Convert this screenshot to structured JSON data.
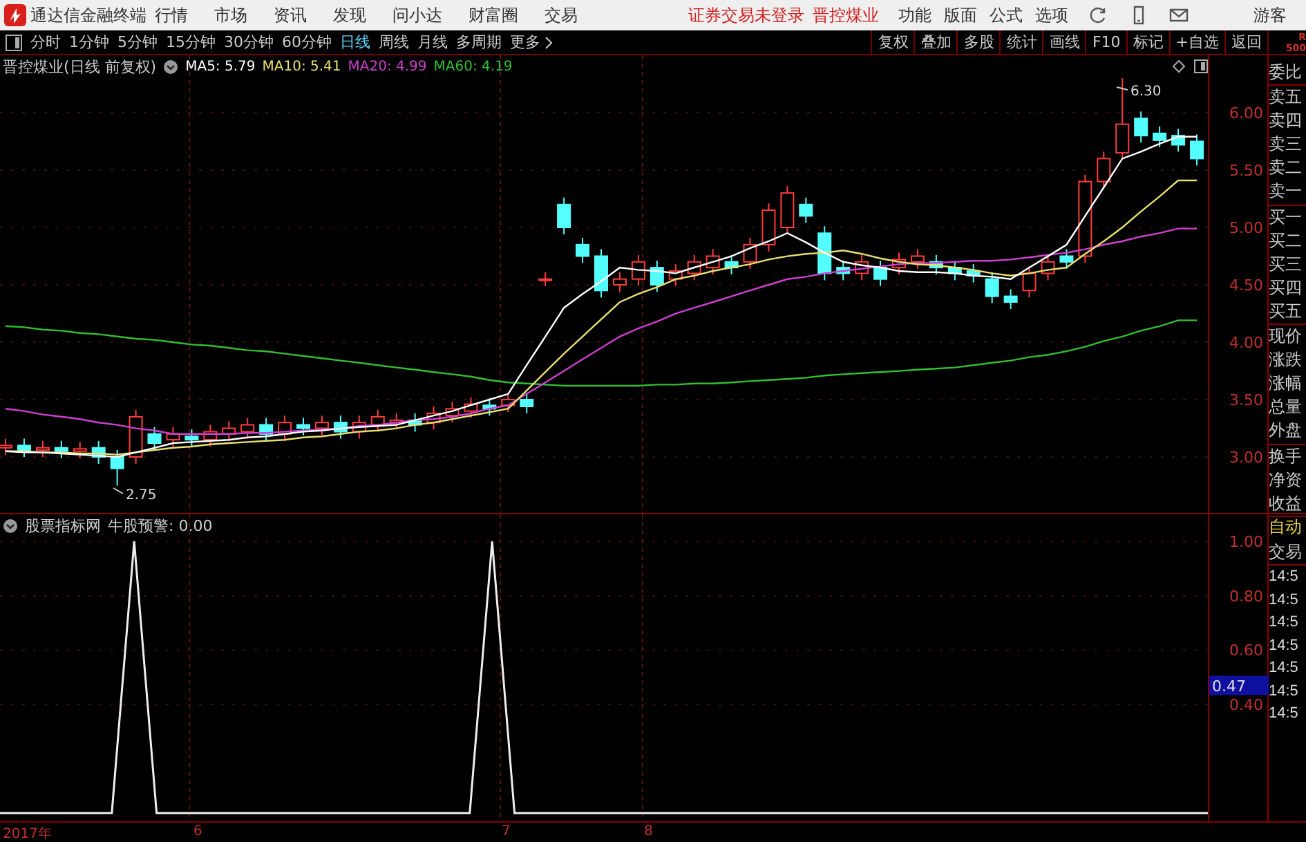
{
  "menu_bar": {
    "app_title": "通达信金融终端",
    "menus": [
      "行情",
      "市场",
      "资讯",
      "发现",
      "问小达",
      "财富圈",
      "交易"
    ],
    "status": [
      "证券交易未登录",
      "晋控煤业"
    ],
    "right_menus": [
      "功能",
      "版面",
      "公式",
      "选项"
    ],
    "user": "游客"
  },
  "period_tabs": [
    {
      "label": "分时",
      "selected": false
    },
    {
      "label": "1分钟",
      "selected": false
    },
    {
      "label": "5分钟",
      "selected": false
    },
    {
      "label": "15分钟",
      "selected": false
    },
    {
      "label": "30分钟",
      "selected": false
    },
    {
      "label": "60分钟",
      "selected": false
    },
    {
      "label": "日线",
      "selected": true
    },
    {
      "label": "周线",
      "selected": false
    },
    {
      "label": "月线",
      "selected": false
    },
    {
      "label": "多周期",
      "selected": false
    },
    {
      "label": "更多",
      "selected": false
    }
  ],
  "toolbar_buttons": [
    "复权",
    "叠加",
    "多股",
    "统计",
    "画线",
    "F10",
    "标记",
    "+自选",
    "返回"
  ],
  "corner_label": [
    "R",
    "500"
  ],
  "main_chart": {
    "title": "晋控煤业(日线 前复权)",
    "high_label": "6.30",
    "low_label": "2.75",
    "chart_data": {
      "type": "candlestick",
      "grid": true,
      "categories": [
        null,
        null,
        null,
        null,
        null,
        null,
        null,
        null,
        null,
        null,
        null,
        null,
        null,
        null,
        null,
        null,
        null,
        null,
        null,
        null,
        null,
        null,
        null,
        null,
        null,
        null,
        null,
        null,
        null,
        null,
        null,
        null,
        null,
        null,
        null,
        null,
        null,
        null,
        null,
        null,
        null,
        null,
        null,
        null,
        null,
        null,
        null,
        null,
        null,
        null,
        null,
        null,
        null,
        null,
        null,
        null,
        null,
        null,
        null,
        null,
        null,
        null,
        null,
        null,
        null
      ],
      "ylim": [
        2.5,
        6.5
      ],
      "yticks": [
        {
          "value": 6,
          "label": "6.00"
        },
        {
          "value": 5.5,
          "label": "5.50"
        },
        {
          "value": 5,
          "label": "5.00"
        },
        {
          "value": 4.5,
          "label": "4.50"
        },
        {
          "value": 4,
          "label": "4.00"
        },
        {
          "value": 3.5,
          "label": "3.50"
        },
        {
          "value": 3,
          "label": "3.00"
        }
      ],
      "ohlc": [
        [
          3.08,
          3.16,
          3.02,
          3.1
        ],
        [
          3.1,
          3.16,
          3.0,
          3.06
        ],
        [
          3.06,
          3.14,
          3.0,
          3.08
        ],
        [
          3.08,
          3.14,
          2.99,
          3.05
        ],
        [
          3.05,
          3.13,
          2.99,
          3.07
        ],
        [
          3.08,
          3.14,
          2.94,
          3.0
        ],
        [
          3.0,
          3.06,
          2.75,
          2.9
        ],
        [
          3.0,
          3.41,
          2.94,
          3.35
        ],
        [
          3.2,
          3.26,
          3.06,
          3.12
        ],
        [
          3.15,
          3.26,
          3.09,
          3.2
        ],
        [
          3.18,
          3.24,
          3.09,
          3.15
        ],
        [
          3.15,
          3.28,
          3.09,
          3.22
        ],
        [
          3.2,
          3.31,
          3.14,
          3.25
        ],
        [
          3.22,
          3.34,
          3.16,
          3.28
        ],
        [
          3.28,
          3.34,
          3.14,
          3.2
        ],
        [
          3.2,
          3.36,
          3.14,
          3.3
        ],
        [
          3.28,
          3.34,
          3.19,
          3.25
        ],
        [
          3.25,
          3.36,
          3.19,
          3.3
        ],
        [
          3.3,
          3.36,
          3.16,
          3.22
        ],
        [
          3.22,
          3.36,
          3.16,
          3.3
        ],
        [
          3.28,
          3.41,
          3.22,
          3.35
        ],
        [
          3.3,
          3.38,
          3.24,
          3.32
        ],
        [
          3.32,
          3.38,
          3.22,
          3.28
        ],
        [
          3.3,
          3.44,
          3.24,
          3.38
        ],
        [
          3.36,
          3.48,
          3.3,
          3.42
        ],
        [
          3.4,
          3.52,
          3.34,
          3.46
        ],
        [
          3.45,
          3.51,
          3.36,
          3.42
        ],
        [
          3.45,
          3.56,
          3.39,
          3.5
        ],
        [
          3.5,
          3.56,
          3.38,
          3.44
        ],
        [
          4.55,
          4.61,
          4.49,
          4.55
        ],
        [
          5.2,
          5.26,
          4.94,
          5.0
        ],
        [
          4.85,
          4.91,
          4.69,
          4.75
        ],
        [
          4.75,
          4.81,
          4.39,
          4.45
        ],
        [
          4.5,
          4.61,
          4.44,
          4.55
        ],
        [
          4.55,
          4.76,
          4.49,
          4.7
        ],
        [
          4.65,
          4.71,
          4.44,
          4.5
        ],
        [
          4.55,
          4.68,
          4.49,
          4.62
        ],
        [
          4.6,
          4.76,
          4.54,
          4.7
        ],
        [
          4.65,
          4.81,
          4.59,
          4.75
        ],
        [
          4.7,
          4.76,
          4.59,
          4.65
        ],
        [
          4.7,
          4.91,
          4.64,
          4.85
        ],
        [
          4.85,
          5.21,
          4.79,
          5.15
        ],
        [
          5.0,
          5.36,
          4.94,
          5.3
        ],
        [
          5.2,
          5.26,
          5.04,
          5.1
        ],
        [
          4.95,
          5.01,
          4.54,
          4.6
        ],
        [
          4.65,
          4.71,
          4.54,
          4.6
        ],
        [
          4.6,
          4.76,
          4.54,
          4.7
        ],
        [
          4.65,
          4.71,
          4.49,
          4.55
        ],
        [
          4.65,
          4.78,
          4.59,
          4.72
        ],
        [
          4.7,
          4.81,
          4.64,
          4.75
        ],
        [
          4.7,
          4.76,
          4.59,
          4.65
        ],
        [
          4.65,
          4.71,
          4.54,
          4.6
        ],
        [
          4.62,
          4.68,
          4.52,
          4.58
        ],
        [
          4.55,
          4.61,
          4.34,
          4.4
        ],
        [
          4.4,
          4.46,
          4.29,
          4.35
        ],
        [
          4.45,
          4.66,
          4.39,
          4.6
        ],
        [
          4.6,
          4.76,
          4.54,
          4.7
        ],
        [
          4.75,
          4.81,
          4.64,
          4.7
        ],
        [
          4.75,
          5.46,
          4.69,
          5.4
        ],
        [
          5.4,
          5.66,
          5.34,
          5.6
        ],
        [
          5.65,
          6.3,
          5.59,
          5.9
        ],
        [
          5.95,
          6.01,
          5.74,
          5.8
        ],
        [
          5.82,
          5.88,
          5.7,
          5.76
        ],
        [
          5.8,
          5.86,
          5.66,
          5.72
        ],
        [
          5.75,
          5.81,
          5.54,
          5.6
        ]
      ],
      "series": [
        {
          "name": "MA5: 5.79",
          "type": "line",
          "color": "#ffffff",
          "values": [
            3.05,
            3.04,
            3.04,
            3.03,
            3.02,
            3.01,
            3.0,
            3.04,
            3.08,
            3.12,
            3.13,
            3.14,
            3.15,
            3.17,
            3.18,
            3.2,
            3.22,
            3.23,
            3.25,
            3.26,
            3.27,
            3.28,
            3.32,
            3.36,
            3.4,
            3.45,
            3.5,
            3.55,
            3.8,
            4.05,
            4.3,
            4.42,
            4.53,
            4.65,
            4.63,
            4.62,
            4.6,
            4.65,
            4.7,
            4.75,
            4.82,
            4.88,
            4.95,
            4.87,
            4.78,
            4.7,
            4.67,
            4.65,
            4.62,
            4.61,
            4.61,
            4.6,
            4.58,
            4.57,
            4.55,
            4.65,
            4.75,
            4.85,
            5.1,
            5.35,
            5.6,
            5.66,
            5.73,
            5.79,
            5.79
          ]
        },
        {
          "name": "MA10: 5.41",
          "type": "line",
          "color": "#e8e070",
          "values": [
            3.05,
            3.05,
            3.04,
            3.04,
            3.03,
            3.03,
            3.02,
            3.04,
            3.06,
            3.08,
            3.09,
            3.11,
            3.12,
            3.13,
            3.14,
            3.15,
            3.17,
            3.18,
            3.2,
            3.22,
            3.23,
            3.25,
            3.28,
            3.3,
            3.33,
            3.36,
            3.39,
            3.42,
            3.58,
            3.74,
            3.9,
            4.05,
            4.2,
            4.35,
            4.42,
            4.48,
            4.55,
            4.58,
            4.62,
            4.65,
            4.68,
            4.72,
            4.75,
            4.77,
            4.78,
            4.8,
            4.77,
            4.73,
            4.7,
            4.68,
            4.67,
            4.65,
            4.63,
            4.6,
            4.58,
            4.6,
            4.63,
            4.65,
            4.77,
            4.88,
            5.0,
            5.14,
            5.27,
            5.41,
            5.41
          ]
        },
        {
          "name": "MA20: 4.99",
          "type": "line",
          "color": "#d040d0",
          "values": [
            3.42,
            3.4,
            3.37,
            3.35,
            3.33,
            3.3,
            3.28,
            3.25,
            3.23,
            3.2,
            3.2,
            3.2,
            3.2,
            3.21,
            3.21,
            3.22,
            3.23,
            3.24,
            3.25,
            3.27,
            3.28,
            3.3,
            3.32,
            3.33,
            3.35,
            3.38,
            3.42,
            3.45,
            3.55,
            3.65,
            3.75,
            3.85,
            3.95,
            4.05,
            4.12,
            4.18,
            4.25,
            4.3,
            4.35,
            4.4,
            4.45,
            4.5,
            4.55,
            4.57,
            4.6,
            4.62,
            4.64,
            4.66,
            4.68,
            4.69,
            4.69,
            4.7,
            4.71,
            4.71,
            4.72,
            4.74,
            4.76,
            4.78,
            4.81,
            4.85,
            4.88,
            4.92,
            4.95,
            4.99,
            4.99
          ]
        },
        {
          "name": "MA60: 4.19",
          "type": "line",
          "color": "#30c030",
          "values": [
            4.14,
            4.13,
            4.11,
            4.1,
            4.08,
            4.07,
            4.05,
            4.03,
            4.02,
            4.0,
            3.98,
            3.97,
            3.95,
            3.93,
            3.92,
            3.9,
            3.88,
            3.86,
            3.84,
            3.82,
            3.8,
            3.78,
            3.76,
            3.74,
            3.72,
            3.7,
            3.67,
            3.65,
            3.64,
            3.63,
            3.62,
            3.62,
            3.62,
            3.62,
            3.62,
            3.63,
            3.63,
            3.64,
            3.64,
            3.65,
            3.66,
            3.67,
            3.68,
            3.69,
            3.71,
            3.72,
            3.73,
            3.74,
            3.75,
            3.76,
            3.77,
            3.78,
            3.8,
            3.82,
            3.84,
            3.87,
            3.89,
            3.92,
            3.96,
            4.01,
            4.05,
            4.1,
            4.14,
            4.19,
            4.19
          ]
        }
      ]
    }
  },
  "quote_panel": [
    "委比",
    "卖五",
    "卖四",
    "卖三",
    "卖二",
    "卖一",
    "买一",
    "买二",
    "买三",
    "买四",
    "买五",
    "现价",
    "涨跌",
    "涨幅",
    "总量",
    "外盘",
    "换手",
    "净资",
    "收益"
  ],
  "indicator": {
    "title": "股票指标网",
    "current_value": "0.47",
    "chart_data": {
      "type": "line",
      "grid": true,
      "categories": [
        null,
        null,
        null,
        null,
        null,
        null,
        null,
        null,
        null,
        null,
        null,
        null,
        null,
        null,
        null,
        null,
        null,
        null,
        null,
        null,
        null,
        null,
        null,
        null,
        null,
        null,
        null,
        null,
        null,
        null,
        null,
        null,
        null,
        null,
        null,
        null,
        null,
        null,
        null,
        null,
        null,
        null,
        null,
        null,
        null,
        null,
        null,
        null,
        null,
        null,
        null,
        null,
        null,
        null,
        null
      ],
      "ylim": [
        -0.03,
        1.1
      ],
      "yticks": [
        {
          "value": 1,
          "label": "1.00"
        },
        {
          "value": 0.8,
          "label": "0.80"
        },
        {
          "value": 0.6,
          "label": "0.60"
        },
        {
          "value": 0.4,
          "label": "0.40"
        }
      ],
      "series": [
        {
          "name": "牛股预警: 0.00",
          "color": "#eeeeee",
          "values": [
            0,
            0,
            0,
            0,
            0,
            0,
            1,
            0,
            0,
            0,
            0,
            0,
            0,
            0,
            0,
            0,
            0,
            0,
            0,
            0,
            0,
            0,
            1,
            0,
            0,
            0,
            0,
            0,
            0,
            0,
            0,
            0,
            0,
            0,
            0,
            0,
            0,
            0,
            0,
            0,
            0,
            0,
            0,
            0,
            0,
            0,
            0,
            0,
            0,
            0,
            0,
            0,
            0,
            0,
            0
          ]
        }
      ]
    }
  },
  "trade_panel": {
    "labels": [
      "自动",
      "交易"
    ],
    "times": [
      "14:5",
      "14:5",
      "14:5",
      "14:5",
      "14:5",
      "14:5",
      "14:5"
    ]
  },
  "date_axis": [
    "2017年",
    "6",
    "7",
    "8"
  ]
}
